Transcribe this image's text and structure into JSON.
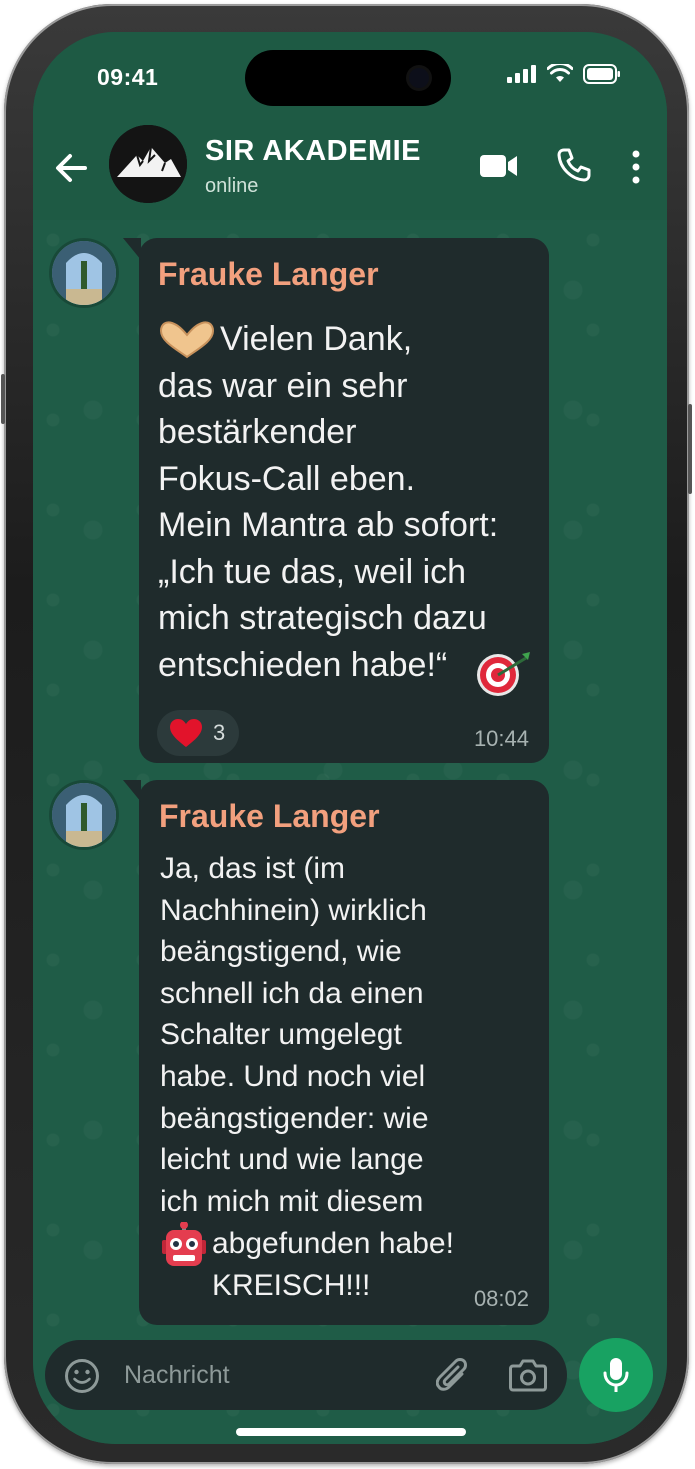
{
  "status_bar": {
    "time": "09:41"
  },
  "header": {
    "title": "SIR AKADEMIE",
    "subtitle": "online"
  },
  "messages": [
    {
      "sender": "Frauke Langer",
      "text": "Vielen Dank,\ndas war ein sehr\nbestärkender\nFokus-Call eben.\nMein Mantra ab sofort:\n„Ich tue das, weil ich\nmich strategisch dazu\nentschieden habe!“",
      "lead_emoji": "heart-hands",
      "trail_emoji": "direct-hit",
      "reaction": {
        "emoji": "red-heart",
        "count": "3"
      },
      "time": "10:44"
    },
    {
      "sender": "Frauke Langer",
      "text": "Ja, das ist (im\nNachhinein) wirklich\nbeängstigend, wie\nschnell ich da einen\nSchalter umgelegt\nhabe. Und noch viel\nbeängstigender: wie\nleicht und wie lange\nich mich mit diesem",
      "text_after_emoji": "abgefunden habe!\nKREISCH!!!",
      "inline_emoji": "robot",
      "time": "08:02"
    }
  ],
  "input": {
    "placeholder": "Nachricht"
  },
  "colors": {
    "header": "#1e5a44",
    "chat_background": "#1f5c47",
    "bubble": "#1f2b2c",
    "sender_name": "#f2a07e",
    "mic_button": "#18a262"
  }
}
